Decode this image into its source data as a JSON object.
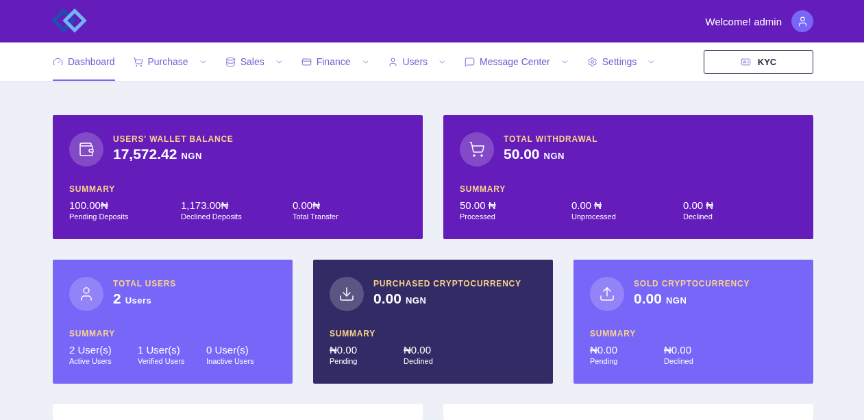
{
  "header": {
    "welcome": "Welcome! admin"
  },
  "nav": [
    {
      "label": "Dashboard",
      "dropdown": false,
      "selected": true
    },
    {
      "label": "Purchase",
      "dropdown": true,
      "selected": false
    },
    {
      "label": "Sales",
      "dropdown": true,
      "selected": false
    },
    {
      "label": "Finance",
      "dropdown": true,
      "selected": false
    },
    {
      "label": "Users",
      "dropdown": true,
      "selected": false
    },
    {
      "label": "Message Center",
      "dropdown": true,
      "selected": false
    },
    {
      "label": "Settings",
      "dropdown": true,
      "selected": false
    }
  ],
  "kyc_button": "KYC",
  "cards": [
    {
      "title": "USERS' WALLET BALANCE",
      "value": "17,572.42",
      "unit": "NGN",
      "color": "#641dbb",
      "summary_label": "SUMMARY",
      "stats": [
        {
          "value": "100.00₦",
          "label": "Pending Deposits"
        },
        {
          "value": "1,173.00₦",
          "label": "Declined Deposits"
        },
        {
          "value": "0.00₦",
          "label": "Total Transfer"
        }
      ]
    },
    {
      "title": "TOTAL WITHDRAWAL",
      "value": "50.00",
      "unit": "NGN",
      "color": "#641dbb",
      "summary_label": "SUMMARY",
      "stats": [
        {
          "value": "50.00 ₦",
          "label": "Processed"
        },
        {
          "value": "0.00 ₦",
          "label": "Unprocessed"
        },
        {
          "value": "0.00 ₦",
          "label": "Declined"
        }
      ]
    },
    {
      "title": "TOTAL USERS",
      "value": "2",
      "unit": "Users",
      "color": "#7766f7",
      "summary_label": "SUMMARY",
      "stats": [
        {
          "value": "2 User(s)",
          "label": "Active Users"
        },
        {
          "value": "1 User(s)",
          "label": "Verified Users"
        },
        {
          "value": "0 User(s)",
          "label": "Inactive Users"
        }
      ]
    },
    {
      "title": "PURCHASED CRYPTOCURRENCY",
      "value": "0.00",
      "unit": "NGN",
      "color": "#332b66",
      "summary_label": "SUMMARY",
      "stats": [
        {
          "value": "₦0.00",
          "label": "Pending"
        },
        {
          "value": "₦0.00",
          "label": "Declined"
        }
      ]
    },
    {
      "title": "SOLD CRYPTOCURRENCY",
      "value": "0.00",
      "unit": "NGN",
      "color": "#7766f7",
      "summary_label": "SUMMARY",
      "stats": [
        {
          "value": "₦0.00",
          "label": "Pending"
        },
        {
          "value": "₦0.00",
          "label": "Declined"
        }
      ]
    }
  ]
}
